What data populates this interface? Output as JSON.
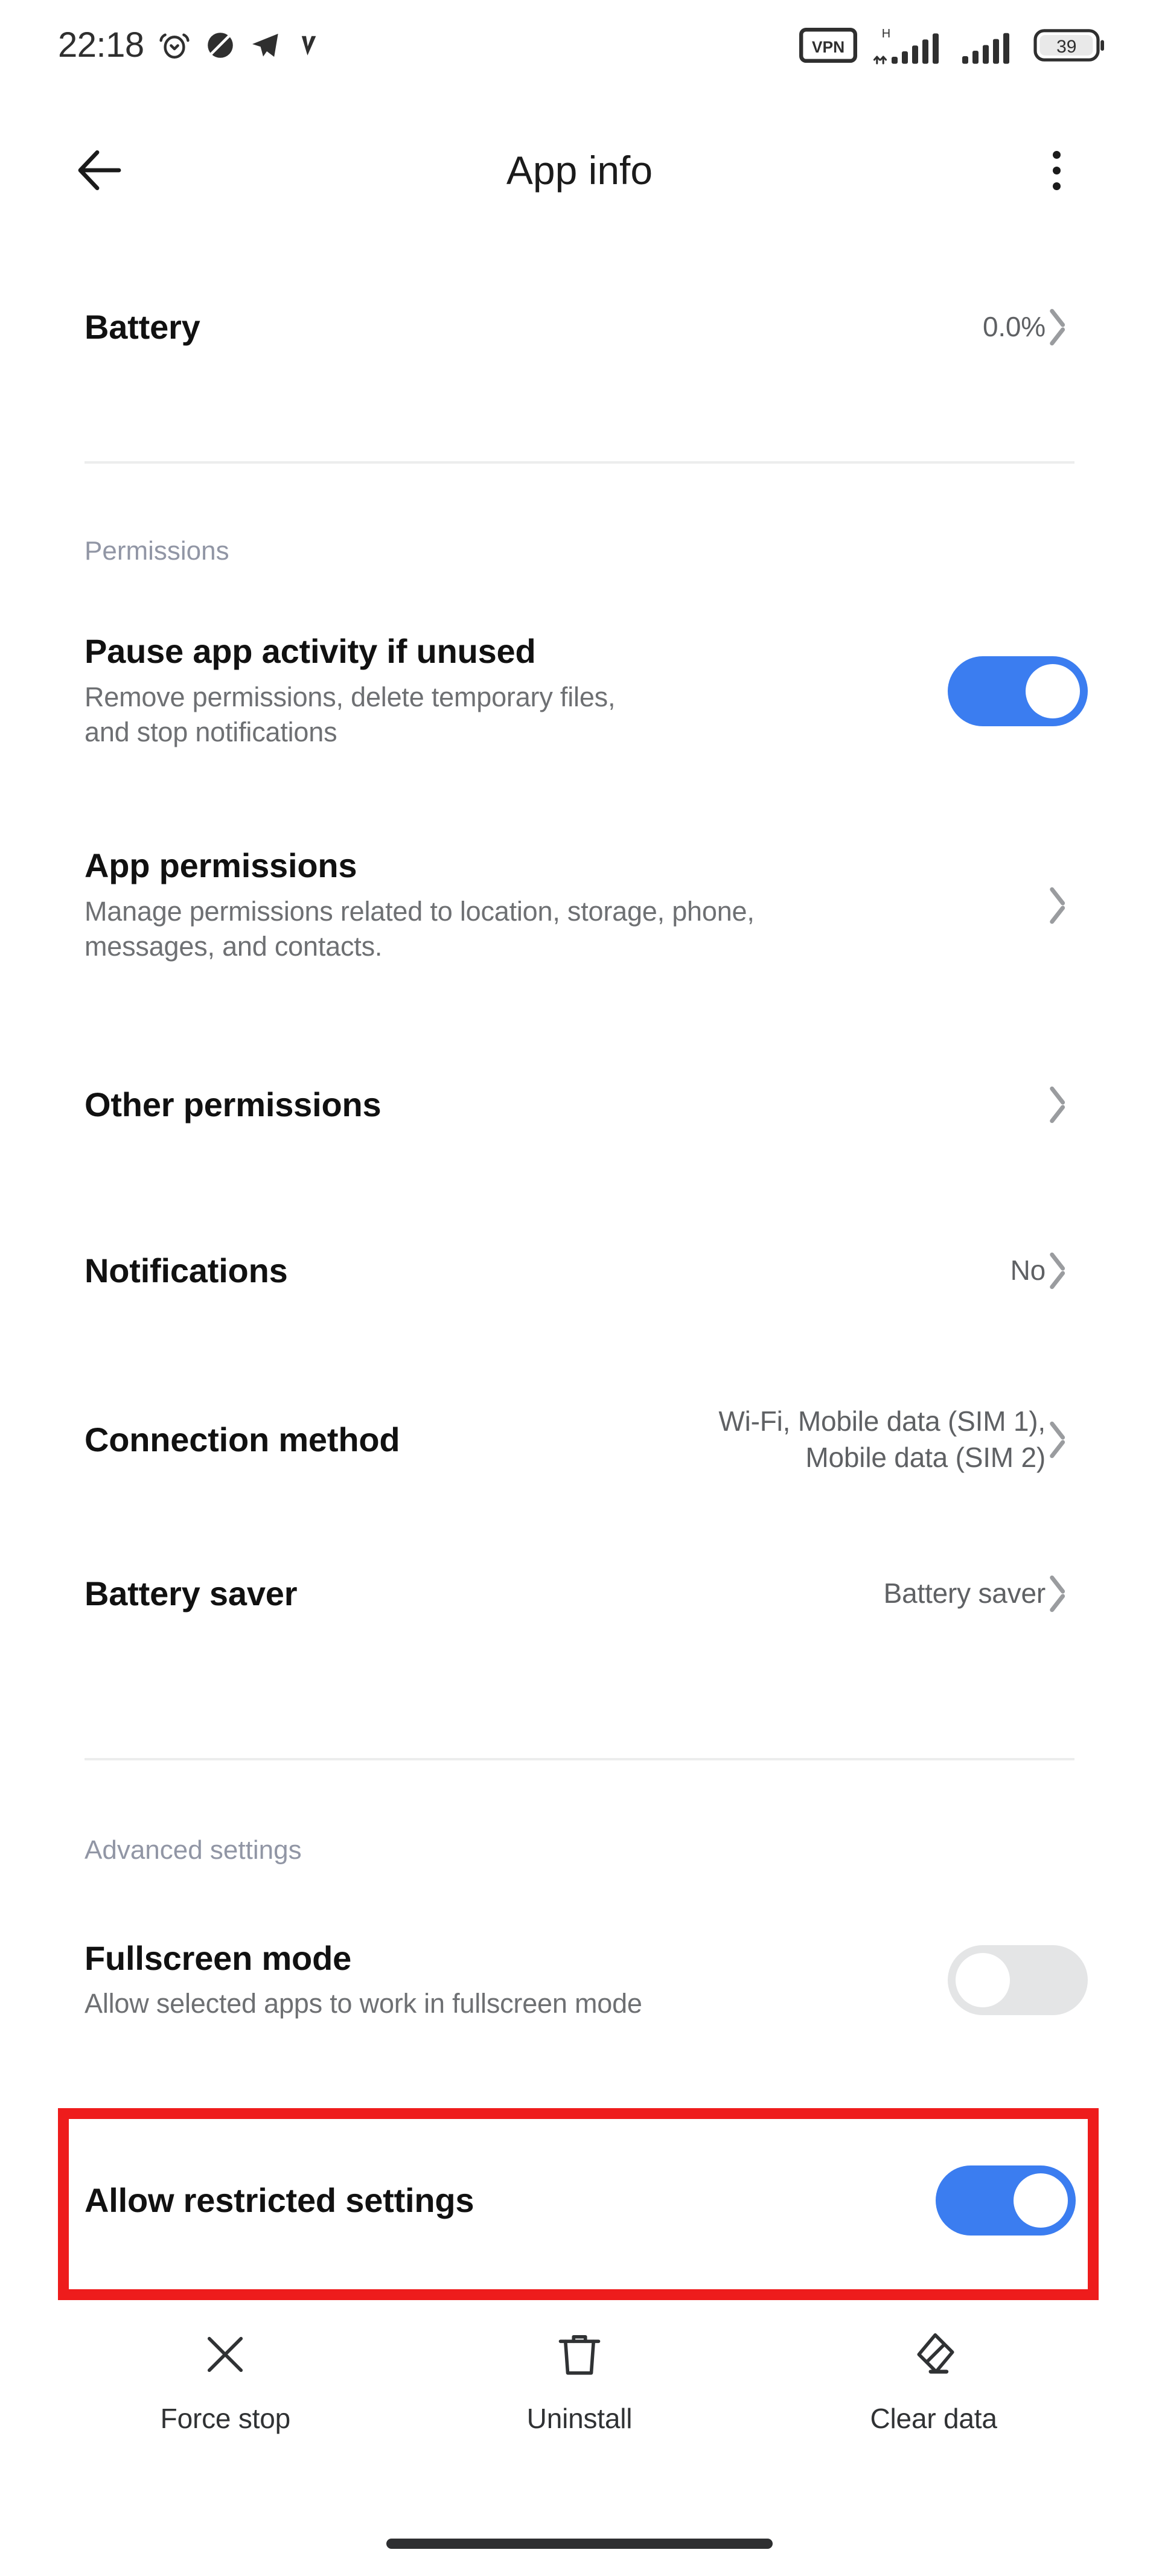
{
  "status_bar": {
    "time": "22:18",
    "left_icons": [
      "alarm-icon",
      "do-not-disturb-icon",
      "telegram-icon",
      "vk-icon"
    ],
    "vpn_label": "VPN",
    "network_type": "H",
    "right_icons": [
      "vpn-icon",
      "signal-sim1-icon",
      "signal-sim2-icon",
      "battery-icon"
    ],
    "battery_level": "39"
  },
  "app_bar": {
    "back_icon": "arrow-left-icon",
    "title": "App info",
    "overflow_icon": "more-vertical-icon"
  },
  "battery_row": {
    "title": "Battery",
    "value": "0.0%",
    "chevron": "chevron-right-icon"
  },
  "permissions_section": {
    "label": "Permissions",
    "items": [
      {
        "title": "Pause app activity if unused",
        "subtitle": "Remove permissions, delete temporary files,\nand stop notifications",
        "control": "toggle",
        "toggle_state": "on"
      },
      {
        "title": "App permissions",
        "subtitle": "Manage permissions related to location, storage, phone,\nmessages, and contacts.",
        "control": "chevron"
      },
      {
        "title": "Other permissions",
        "subtitle": "",
        "control": "chevron"
      },
      {
        "title": "Notifications",
        "value": "No",
        "control": "chevron"
      },
      {
        "title": "Connection method",
        "value": "Wi-Fi, Mobile data (SIM 1),\nMobile data (SIM 2)",
        "control": "chevron"
      },
      {
        "title": "Battery saver",
        "value": "Battery saver",
        "control": "chevron"
      }
    ]
  },
  "advanced_section": {
    "label": "Advanced settings",
    "items": [
      {
        "title": "Fullscreen mode",
        "subtitle": "Allow selected apps to work in fullscreen mode",
        "control": "toggle",
        "toggle_state": "off"
      },
      {
        "title": "Allow restricted settings",
        "subtitle": "",
        "control": "toggle",
        "toggle_state": "on",
        "highlighted": true
      }
    ]
  },
  "action_bar": {
    "actions": [
      {
        "label": "Force stop",
        "icon": "close-x-icon"
      },
      {
        "label": "Uninstall",
        "icon": "trash-icon"
      },
      {
        "label": "Clear data",
        "icon": "eraser-icon"
      }
    ]
  },
  "colors": {
    "toggle_on": "#3b7df0",
    "toggle_off": "#e4e5e6",
    "highlight_red": "#ee1c1c",
    "section_label": "#9196a5",
    "subtitle": "#6e7073"
  },
  "gesture_bar": {
    "present": true
  }
}
